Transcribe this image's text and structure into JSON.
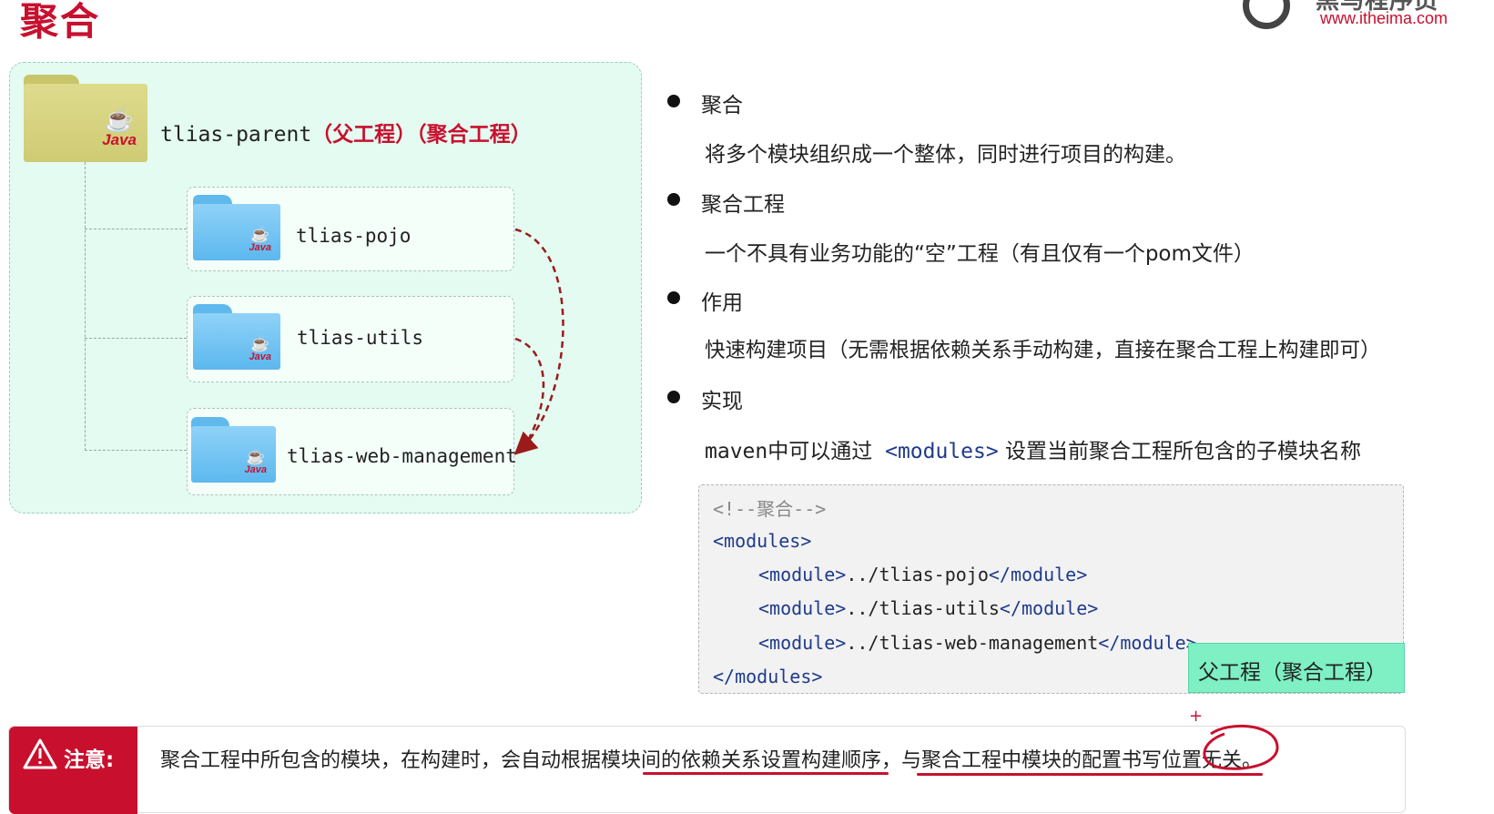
{
  "header": {
    "title": "聚合",
    "logo_cn": "黑马程序员",
    "logo_url": "www.itheima.com"
  },
  "diagram": {
    "parent": {
      "name": "tlias-parent",
      "annotation": "（父工程）（聚合工程）",
      "icon": "java-folder-icon"
    },
    "children": [
      {
        "name": "tlias-pojo"
      },
      {
        "name": "tlias-utils"
      },
      {
        "name": "tlias-web-management"
      }
    ],
    "java_label": "Java"
  },
  "bullets": [
    {
      "title": "聚合",
      "text": "将多个模块组织成一个整体，同时进行项目的构建。"
    },
    {
      "title": "聚合工程",
      "text": "一个不具有业务功能的“空”工程（有且仅有一个pom文件）"
    },
    {
      "title": "作用",
      "text": "快速构建项目（无需根据依赖关系手动构建，直接在聚合工程上构建即可）"
    },
    {
      "title": "实现",
      "text_before": "maven中可以通过 ",
      "text_tag": "<modules>",
      "text_after": " 设置当前聚合工程所包含的子模块名称"
    }
  ],
  "code": {
    "comment": "<!--聚合-->",
    "open_tag": "<modules>",
    "modules": [
      {
        "open": "<module>",
        "path": "../tlias-pojo",
        "close": "</module>"
      },
      {
        "open": "<module>",
        "path": "../tlias-utils",
        "close": "</module>"
      },
      {
        "open": "<module>",
        "path": "../tlias-web-management",
        "close": "</module>"
      }
    ],
    "close_tag": "</modules>"
  },
  "tooltip": "父工程（聚合工程）",
  "note": {
    "label": "注意:",
    "text": "聚合工程中所包含的模块，在构建时，会自动根据模块间的依赖关系设置构建顺序，与聚合工程中模块的配置书写位置无关。"
  },
  "colors": {
    "accent_red": "#c8102e",
    "panel_bg": "#e3fbf0",
    "tooltip_bg": "#7ef0c3",
    "tag_blue": "#1f3b8a"
  }
}
